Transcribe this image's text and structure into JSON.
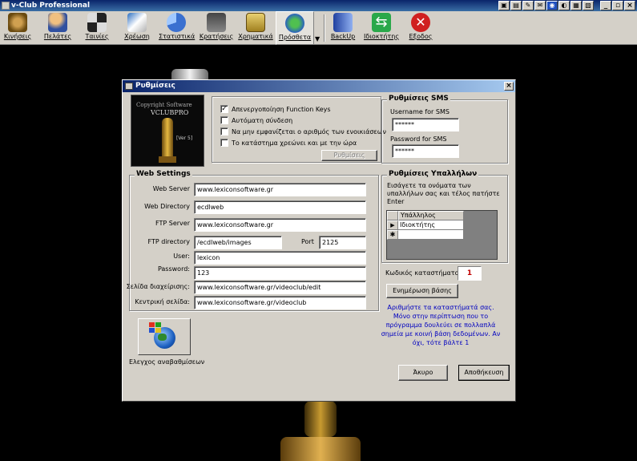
{
  "app": {
    "title": "v-Club Professional"
  },
  "toolbar": [
    {
      "label": "Κινήσεις",
      "icon": "film-reel-icon"
    },
    {
      "label": "Πελάτες",
      "icon": "customers-icon"
    },
    {
      "label": "Ταινίες",
      "icon": "movies-icon"
    },
    {
      "label": "Χρέωση",
      "icon": "billing-icon"
    },
    {
      "label": "Στατιστικά",
      "icon": "pie-chart-icon"
    },
    {
      "label": "Κρατήσεις",
      "icon": "reservations-icon"
    },
    {
      "label": "Χρηματικά",
      "icon": "money-icon"
    },
    {
      "label": "Πρόσθετα",
      "icon": "addons-icon"
    },
    {
      "label": "BackUp",
      "icon": "backup-icon"
    },
    {
      "label": "Ιδιοκτήτης",
      "icon": "owner-icon"
    },
    {
      "label": "Εξοδος",
      "icon": "exit-icon"
    }
  ],
  "dialog": {
    "title": "Ρυθμίσεις",
    "logo": {
      "line1": "Copyright Software",
      "line2": "VCLUBPRO",
      "line3": "[Ver 5]"
    },
    "options": {
      "items": [
        {
          "label": "Απενεργοποίηση Function Keys",
          "checked": true
        },
        {
          "label": "Αυτόματη σύνδεση",
          "checked": false
        },
        {
          "label": "Να μην εμφανίζεται ο αριθμός των ενοικιάσεων",
          "checked": false
        },
        {
          "label": "Το κατάστημα χρεώνει και με την ώρα",
          "checked": false
        }
      ],
      "settings_button": "Ρυθμίσεις"
    },
    "sms": {
      "title": "Ρυθμίσεις SMS",
      "username_label": "Username for SMS",
      "username_value": "******",
      "password_label": "Password for SMS",
      "password_value": "******"
    },
    "web": {
      "title": "Web Settings",
      "web_server_label": "Web Server",
      "web_server": "www.lexiconsoftware.gr",
      "web_directory_label": "Web Directory",
      "web_directory": "ecdlweb",
      "ftp_server_label": "FTP Server",
      "ftp_server": "www.lexiconsoftware.gr",
      "ftp_directory_label": "FTP directory",
      "ftp_directory": "/ecdlweb/images",
      "port_label": "Port",
      "port": "2125",
      "user_label": "User:",
      "user": "lexicon",
      "password_label": "Password:",
      "password": "123",
      "admin_page_label": "Σελίδα διαχείρισης:",
      "admin_page": "www.lexiconsoftware.gr/videoclub/edit",
      "home_page_label": "Κεντρική σελίδα:",
      "home_page": "www.lexiconsoftware.gr/videoclub"
    },
    "employees": {
      "title": "Ρυθμίσεις Υπαλλήλων",
      "instructions": "Εισάγετε τα ονόματα των υπαλλήλων σας και τέλος πατήστε Enter",
      "column": "Υπάλληλος",
      "rows": [
        "Ιδιοκτήτης",
        ""
      ],
      "current_marker": "▶",
      "new_marker": "✱"
    },
    "store_code_label": "Κωδικός καταστήματος",
    "store_code": "1",
    "update_db_button": "Ενημέρωση βάσης",
    "note": "Αριθμήστε τα καταστήματά σας. Μόνο στην περίπτωση που το πρόγραμμα δουλεύει σε πολλαπλά σημεία με κοινή βάση δεδομένων. Αν όχι, τότε βάλτε 1",
    "updates_label": "Ελεγχος αναβαθμίσεων",
    "cancel_button": "Άκυρο",
    "save_button": "Αποθήκευση"
  }
}
